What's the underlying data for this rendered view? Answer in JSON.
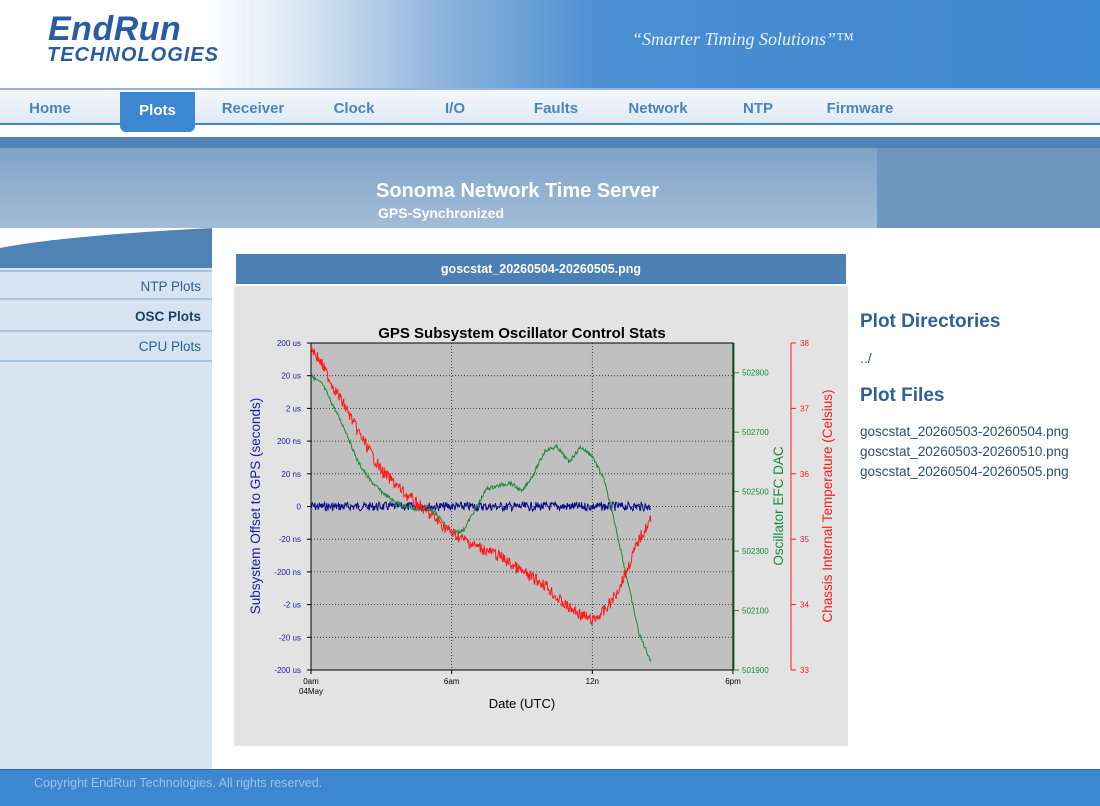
{
  "header": {
    "logo_line1": "EndRun",
    "logo_line2": "TECHNOLOGIES",
    "tagline": "“Smarter Timing Solutions”™"
  },
  "nav": {
    "items": [
      "Home",
      "Plots",
      "Receiver",
      "Clock",
      "I/O",
      "Faults",
      "Network",
      "NTP",
      "Firmware"
    ],
    "active": "Plots"
  },
  "banner": {
    "title": "Sonoma Network Time Server",
    "subtitle": "GPS-Synchronized"
  },
  "sidebar": {
    "items": [
      "NTP Plots",
      "OSC Plots",
      "CPU Plots"
    ],
    "active": "OSC Plots"
  },
  "main": {
    "plot_filename": "goscstat_20260504-20260505.png"
  },
  "directory": {
    "dir_heading": "Plot Directories",
    "parent_link": "../",
    "files_heading": "Plot Files",
    "files": [
      "goscstat_20260503-20260504.png",
      "goscstat_20260503-20260510.png",
      "goscstat_20260504-20260505.png"
    ]
  },
  "footer": {
    "copyright": "Copyright EndRun Technologies. All rights reserved."
  },
  "colors": {
    "accent": "#3d86d0",
    "offset_series": "#0a0a8c",
    "dac_series": "#1a8a3a",
    "temp_series": "#ff1a1a",
    "plot_background": "#c0c0c0"
  },
  "chart_data": {
    "type": "line",
    "title": "GPS Subsystem Oscillator Control Stats",
    "xlabel": "Date (UTC)",
    "x_ticks": [
      "0am",
      "6am",
      "12n",
      "6pm"
    ],
    "x_tick_sublabel": "04May",
    "x_range_hours": [
      0,
      18
    ],
    "grid": true,
    "axes": {
      "left": {
        "label": "Subsystem Offset to GPS (seconds)",
        "ticks": [
          "200 us",
          "20 us",
          "2 us",
          "200 ns",
          "20 ns",
          "0",
          "-20 ns",
          "-200 ns",
          "-2 us",
          "-20 us",
          "-200 us"
        ],
        "scale": "symmetric-log"
      },
      "right_inner": {
        "label": "Oscillator EFC DAC",
        "ticks": [
          502900,
          502700,
          502500,
          502300,
          502100,
          501900
        ],
        "range": [
          501900,
          503000
        ]
      },
      "right_outer": {
        "label": "Chassis Internal Temperature (Celsius)",
        "ticks": [
          38,
          37,
          36,
          35,
          34,
          33
        ],
        "range": [
          33,
          38
        ]
      }
    },
    "series": [
      {
        "axis": "left",
        "x": [
          0,
          2,
          4,
          6,
          8,
          10,
          12,
          14.5
        ],
        "y": [
          0,
          0,
          0,
          0,
          0,
          0,
          0,
          0
        ]
      },
      {
        "axis": "right_inner",
        "x": [
          0,
          0.5,
          1,
          1.5,
          2,
          2.5,
          3,
          3.5,
          4,
          4.5,
          5,
          5.5,
          6,
          6.5,
          7,
          7.5,
          8,
          8.5,
          9,
          9.5,
          10,
          10.5,
          11,
          11.5,
          12,
          12.5,
          13,
          13.5,
          14,
          14.5
        ],
        "y": [
          502890,
          502860,
          502780,
          502700,
          502600,
          502540,
          502500,
          502470,
          502450,
          502440,
          502450,
          502410,
          502360,
          502370,
          502440,
          502510,
          502520,
          502530,
          502500,
          502560,
          502640,
          502650,
          502600,
          502650,
          502620,
          502540,
          502380,
          502200,
          502020,
          501930
        ]
      },
      {
        "axis": "right_outer",
        "x": [
          0,
          0.5,
          1,
          1.5,
          2,
          3,
          4,
          5,
          6,
          7,
          8,
          9,
          10,
          10.5,
          11,
          11.5,
          12,
          12.5,
          13,
          13.5,
          14,
          14.5
        ],
        "y": [
          37.95,
          37.65,
          37.3,
          37.0,
          36.65,
          36.05,
          35.7,
          35.4,
          35.1,
          34.9,
          34.75,
          34.5,
          34.3,
          34.1,
          33.95,
          33.85,
          33.75,
          33.9,
          34.15,
          34.55,
          35.0,
          35.3
        ]
      }
    ]
  }
}
